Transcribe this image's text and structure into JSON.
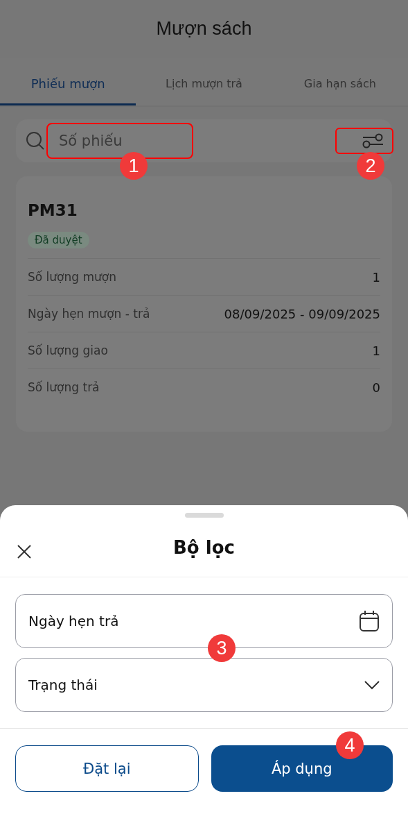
{
  "header": {
    "title": "Mượn sách"
  },
  "tabs": [
    {
      "label": "Phiếu mượn",
      "selected": true
    },
    {
      "label": "Lịch mượn trả",
      "selected": false
    },
    {
      "label": "Gia hạn sách",
      "selected": false
    }
  ],
  "search": {
    "placeholder": "Số phiếu"
  },
  "card": {
    "code": "PM31",
    "status": "Đã duyệt",
    "rows": [
      {
        "label": "Số lượng mượn",
        "value": "1"
      },
      {
        "label": "Ngày hẹn mượn - trả",
        "value": "08/09/2025 - 09/09/2025"
      },
      {
        "label": "Số lượng giao",
        "value": "1"
      },
      {
        "label": "Số lượng trả",
        "value": "0"
      }
    ]
  },
  "sheet": {
    "title": "Bộ lọc",
    "fields": [
      {
        "kind": "date",
        "label": "Ngày hẹn trả"
      },
      {
        "kind": "select",
        "label": "Trạng thái"
      }
    ],
    "buttons": [
      {
        "kind": "secondary",
        "label": "Đặt lại"
      },
      {
        "kind": "primary",
        "label": "Áp dụng"
      }
    ]
  },
  "annotations": [
    {
      "label": "1"
    },
    {
      "label": "2"
    },
    {
      "label": "3"
    },
    {
      "label": "4"
    }
  ]
}
